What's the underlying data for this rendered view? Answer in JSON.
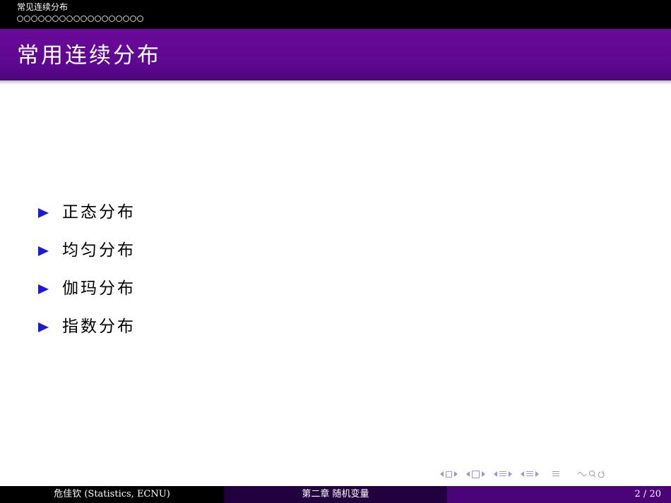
{
  "header": {
    "section_title": "常见连续分布",
    "nav_dot_count": 18
  },
  "frame": {
    "title": "常用连续分布"
  },
  "items": [
    {
      "label": "正态分布"
    },
    {
      "label": "均匀分布"
    },
    {
      "label": "伽玛分布"
    },
    {
      "label": "指数分布"
    }
  ],
  "footer": {
    "author": "危佳钦  (Statistics, ECNU)",
    "chapter": "第二章    随机变量",
    "page": "2 / 20"
  },
  "colors": {
    "title_bar": "#5d0790",
    "bullet": "#1a1adb",
    "footer_left": "#000000",
    "footer_mid": "#220040",
    "footer_right": "#4b0478"
  },
  "nav_icons": [
    "frame-prev-icon",
    "frame-icon",
    "frame-next-icon",
    "subsection-prev-icon",
    "subsection-icon",
    "subsection-next-icon",
    "section-prev-icon",
    "section-icon",
    "section-next-icon",
    "appendix-icon",
    "search-icon",
    "back-icon"
  ]
}
